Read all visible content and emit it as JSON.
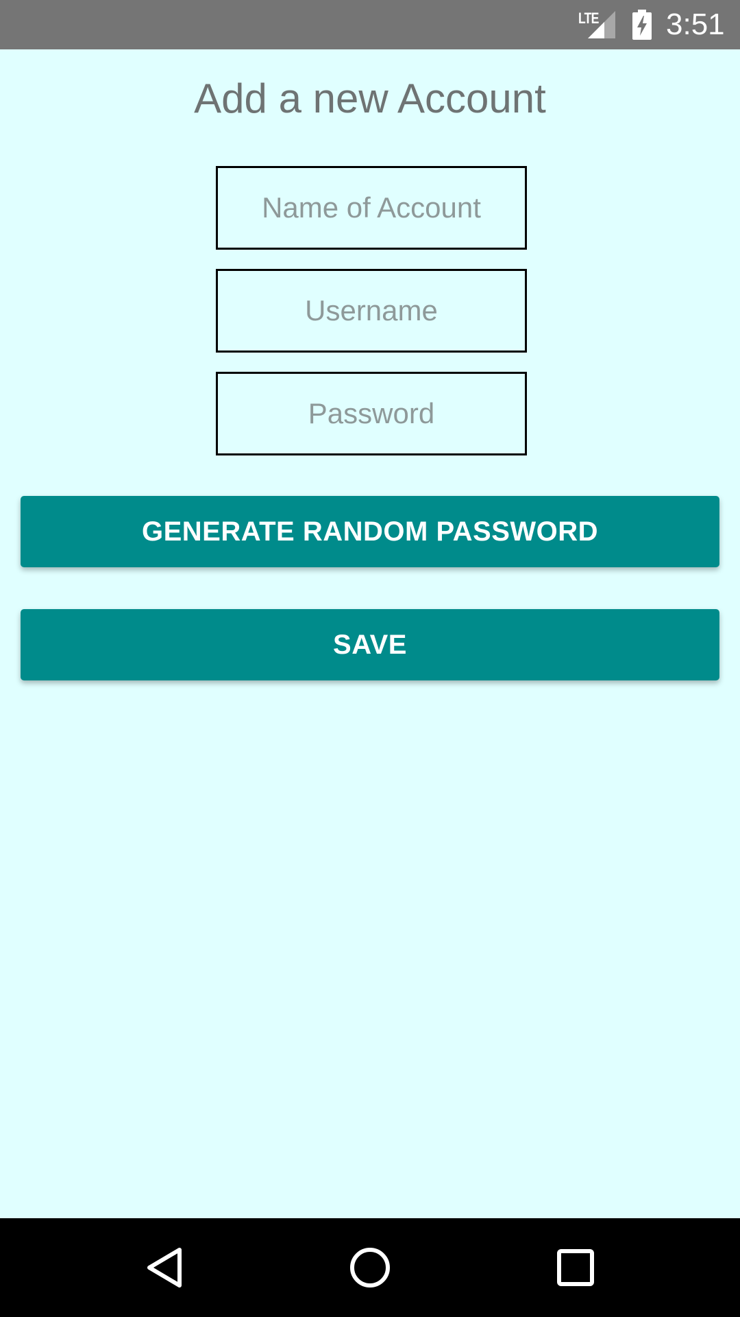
{
  "status_bar": {
    "network_label": "LTE",
    "time": "3:51",
    "icons": [
      "lte-signal-icon",
      "battery-charging-icon"
    ]
  },
  "page": {
    "title": "Add a new Account",
    "background_color": "#E0FFFF"
  },
  "form": {
    "account_name": {
      "value": "",
      "placeholder": "Name of Account"
    },
    "username": {
      "value": "",
      "placeholder": "Username"
    },
    "password": {
      "value": "",
      "placeholder": "Password"
    }
  },
  "buttons": {
    "generate_label": "GENERATE RANDOM PASSWORD",
    "save_label": "SAVE",
    "color": "#008B8B"
  },
  "nav_bar": {
    "icons": [
      "back-icon",
      "home-icon",
      "recents-icon"
    ]
  }
}
